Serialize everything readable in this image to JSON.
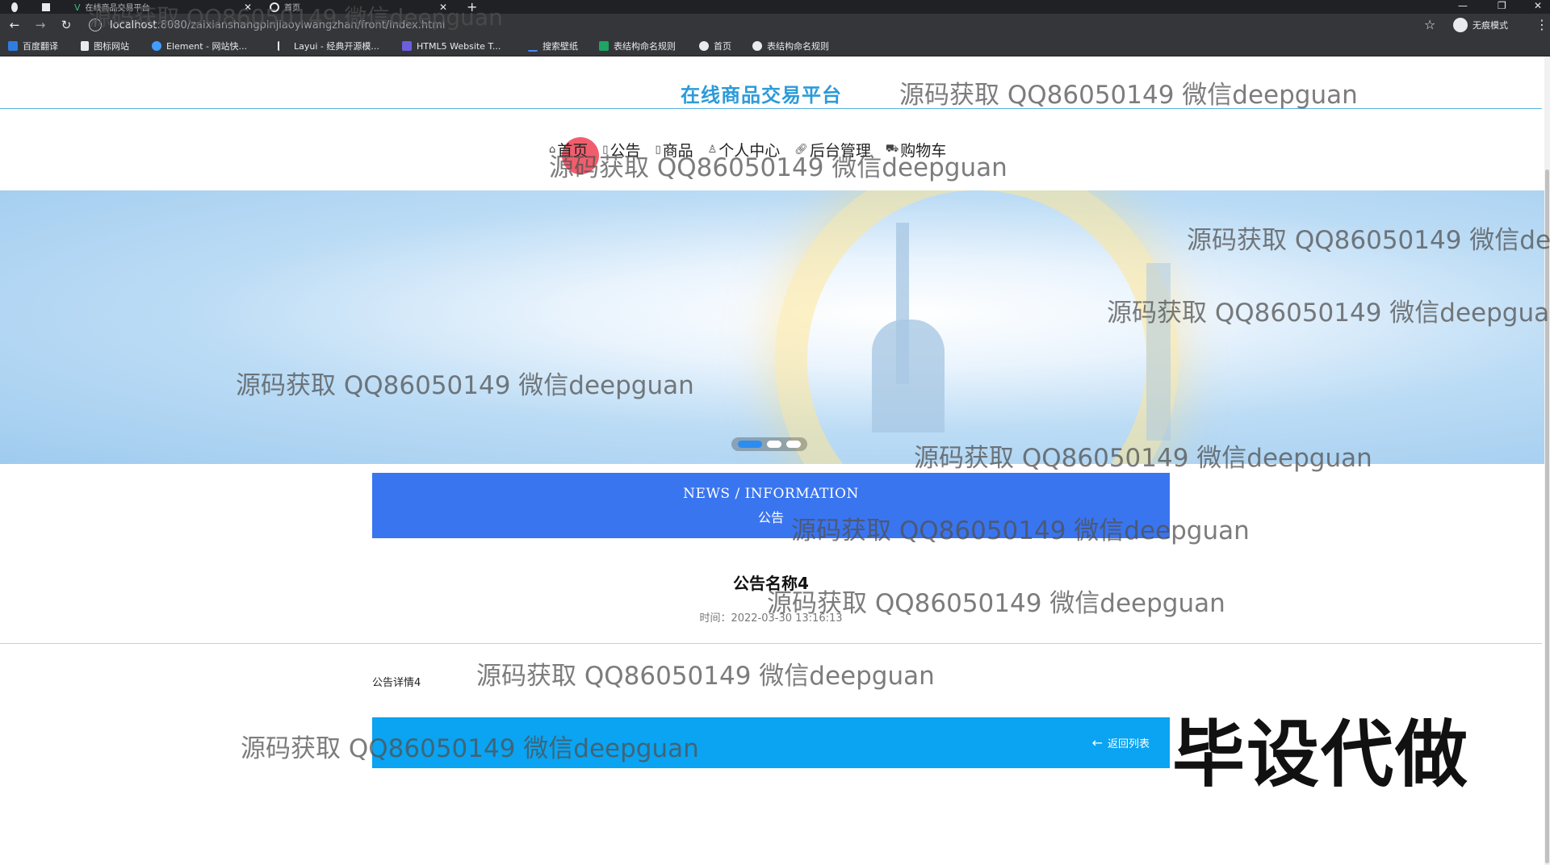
{
  "browser": {
    "tabs": [
      {
        "title": "在线商品交易平台"
      },
      {
        "title": "首页"
      }
    ],
    "new_tab": "+",
    "address": {
      "host": "localhost",
      "rest": ":8080/zaixianshangpinjiaoyiwangzhan/front/index.html"
    },
    "profile_label": "无痕模式",
    "bookmarks": [
      "百度翻译",
      "图标网站",
      "Element - 网站快...",
      "Layui - 经典开源模...",
      "HTML5 Website T...",
      "搜索壁纸",
      "表结构命名规则",
      "首页",
      "表结构命名规则"
    ]
  },
  "site": {
    "title": "在线商品交易平台",
    "nav": [
      {
        "label": "首页",
        "icon": "home-icon"
      },
      {
        "label": "公告",
        "icon": "notice-icon"
      },
      {
        "label": "商品",
        "icon": "goods-icon"
      },
      {
        "label": "个人中心",
        "icon": "user-icon"
      },
      {
        "label": "后台管理",
        "icon": "link-icon"
      },
      {
        "label": "购物车",
        "icon": "cart-icon"
      }
    ]
  },
  "news": {
    "heading_en": "NEWS / INFORMATION",
    "heading_cn": "公告"
  },
  "notice": {
    "title": "公告名称4",
    "time": "时间：2022-03-30 13:16:13",
    "content": "公告详情4"
  },
  "back_button": {
    "label": "返回列表"
  },
  "watermarks": {
    "text": "源码获取 QQ86050149 微信deepguan",
    "big": "毕设代做"
  },
  "colors": {
    "title": "#2c9bd9",
    "news_box": "#3a75f0",
    "bottom_bar": "#0aa4f2"
  }
}
